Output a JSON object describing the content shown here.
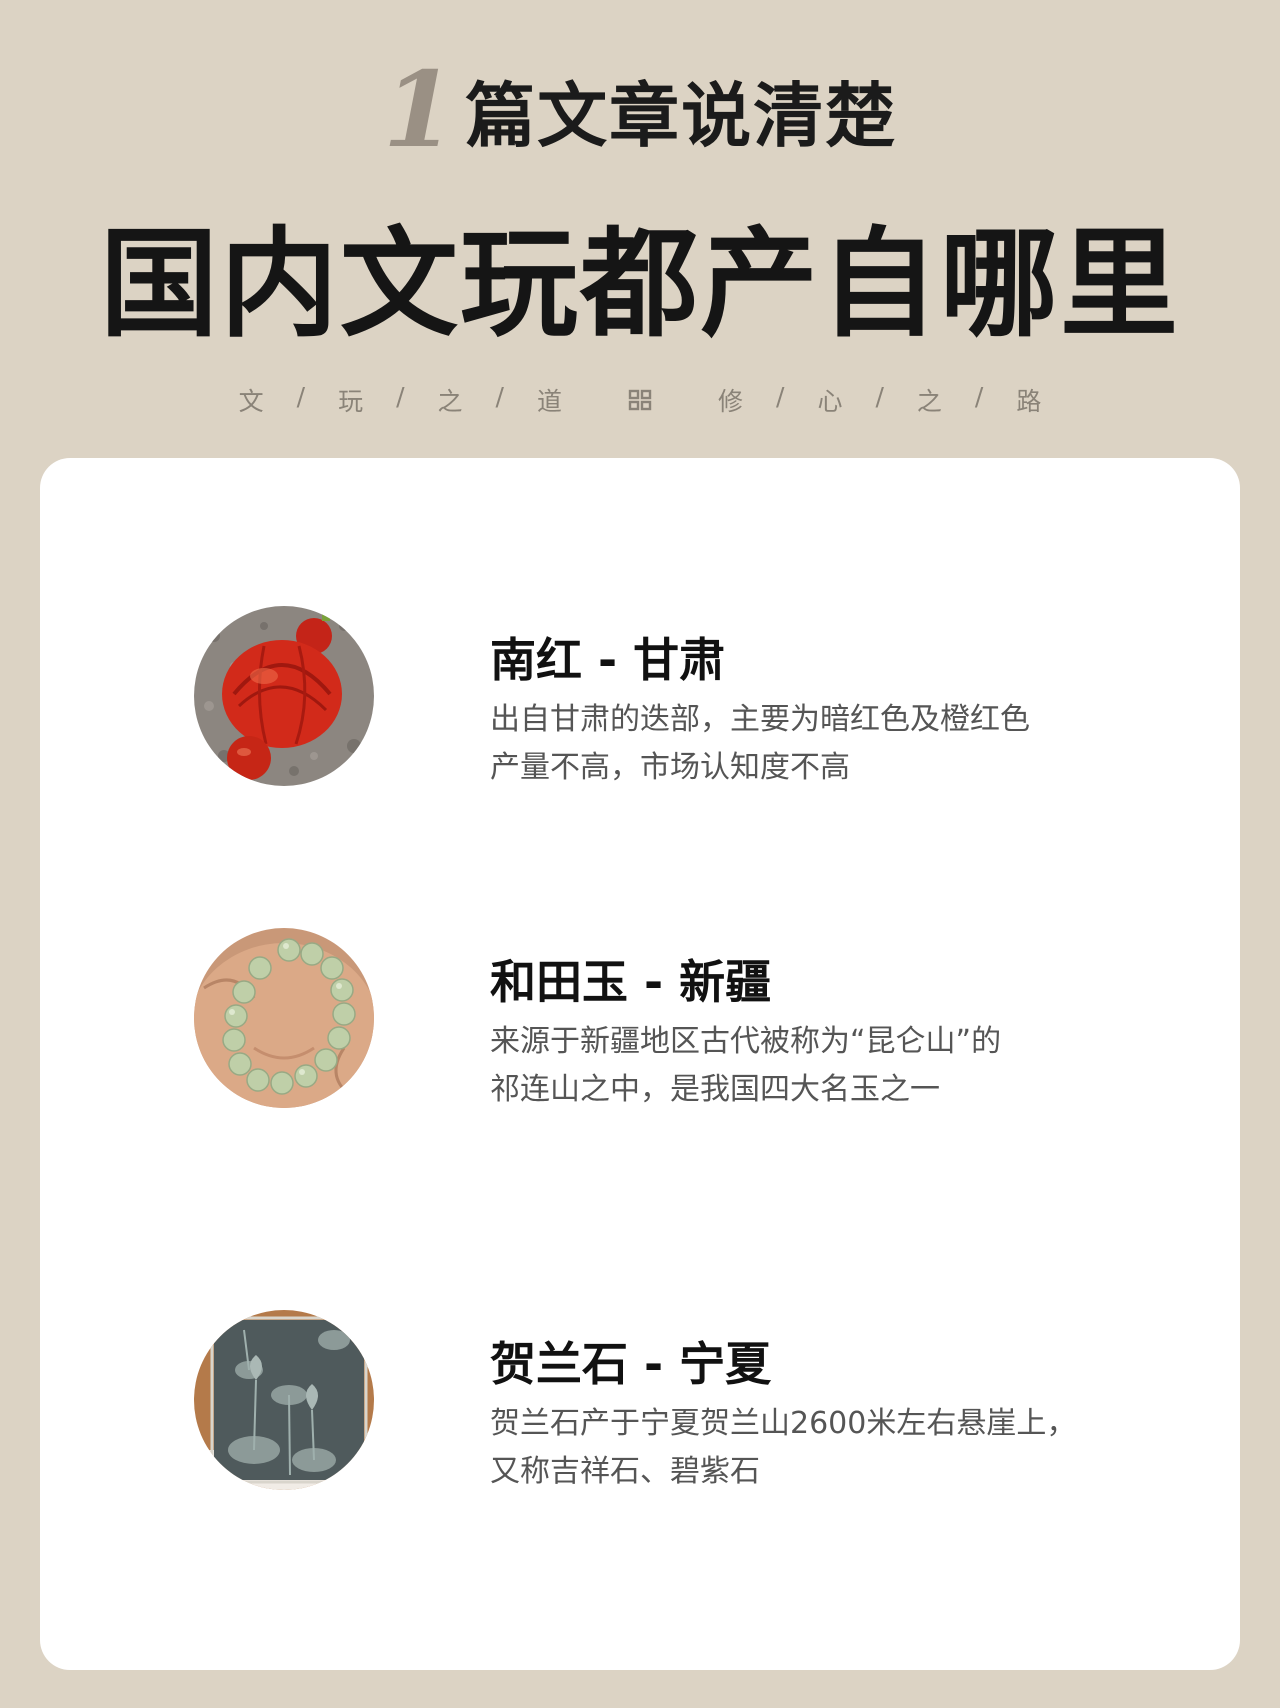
{
  "header": {
    "number": "1",
    "subtitle": "篇文章说清楚",
    "title": "国内文玩都产自哪里",
    "motto_left": [
      "文",
      "/",
      "玩",
      "/",
      "之",
      "/",
      "道"
    ],
    "motto_right": [
      "修",
      "/",
      "心",
      "/",
      "之",
      "/",
      "路"
    ]
  },
  "items": [
    {
      "name": "南红 - 甘肃",
      "desc_line1": "出自甘肃的迭部，主要为暗红色及橙红色",
      "desc_line2": "产量不高，市场认知度不高",
      "icon": "red-agate-photo"
    },
    {
      "name": "和田玉 - 新疆",
      "desc_line1": "来源于新疆地区古代被称为“昆仑山”的",
      "desc_line2": "祁连山之中，是我国四大名玉之一",
      "icon": "jade-bracelet-photo"
    },
    {
      "name": "贺兰石 - 宁夏",
      "desc_line1": "贺兰石产于宁夏贺兰山2600米左右悬崖上，",
      "desc_line2": "又称吉祥石、碧紫石",
      "icon": "helan-stone-carving-photo"
    }
  ],
  "colors": {
    "background": "#dcd3c4",
    "card": "#ffffff",
    "title": "#151515",
    "number": "#9a9084",
    "motto": "#8a8378",
    "desc": "#555555"
  }
}
